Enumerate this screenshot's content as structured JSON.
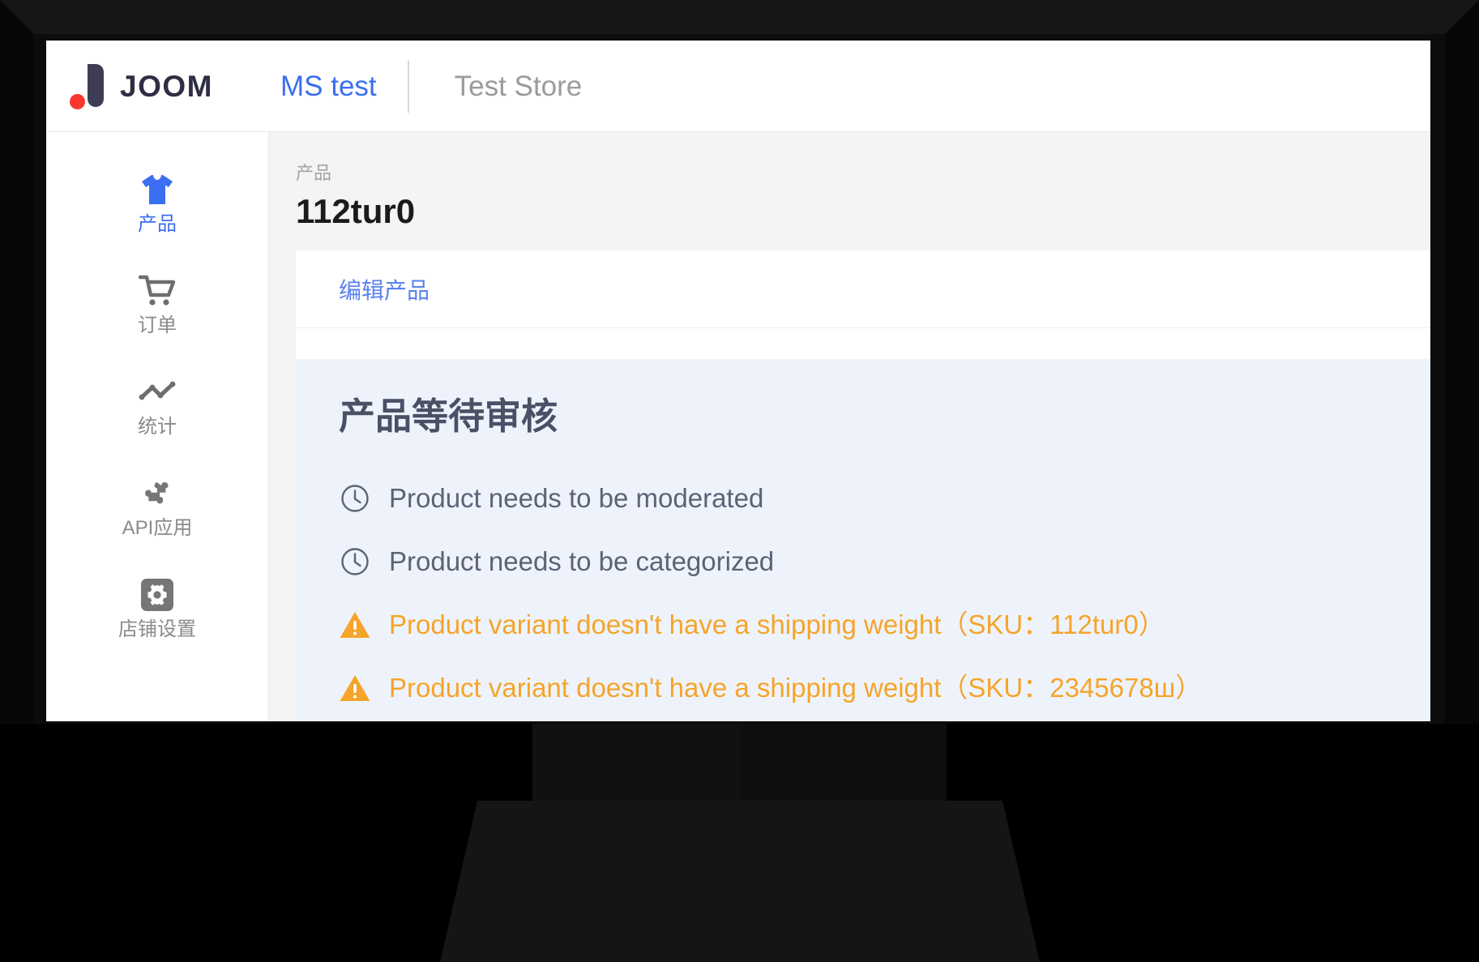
{
  "topbar": {
    "brand_word": "JOOM",
    "brand_mark_icon": "joom-logo-icon",
    "shop_link": "MS test",
    "store_name": "Test Store"
  },
  "sidebar": {
    "items": [
      {
        "label": "产品",
        "icon": "tshirt-icon",
        "active": true
      },
      {
        "label": "订单",
        "icon": "cart-icon",
        "active": false
      },
      {
        "label": "统计",
        "icon": "line-chart-icon",
        "active": false
      },
      {
        "label": "API应用",
        "icon": "puzzle-icon",
        "active": false
      },
      {
        "label": "店铺设置",
        "icon": "gear-icon",
        "active": false
      }
    ]
  },
  "page": {
    "breadcrumb": "产品",
    "title": "112tur0"
  },
  "tabs": [
    {
      "label": "编辑产品",
      "active": true
    }
  ],
  "alert": {
    "title": "产品等待审核",
    "rows": [
      {
        "type": "info",
        "icon": "clock-icon",
        "text": "Product needs to be moderated"
      },
      {
        "type": "info",
        "icon": "clock-icon",
        "text": "Product needs to be categorized"
      },
      {
        "type": "warn",
        "icon": "warning-icon",
        "text": "Product variant doesn't have a shipping weight（SKU：112tur0）"
      },
      {
        "type": "warn",
        "icon": "warning-icon",
        "text": "Product variant doesn't have a shipping weight（SKU：2345678ш）"
      }
    ]
  },
  "colors": {
    "brand_blue": "#3b6ef0",
    "brand_navy": "#3d3d56",
    "brand_red": "#f8372f",
    "warning_orange": "#f6a42a",
    "info_slate": "#5d6375",
    "alert_bg": "#eef3fb",
    "content_bg": "#f4f4f5"
  }
}
